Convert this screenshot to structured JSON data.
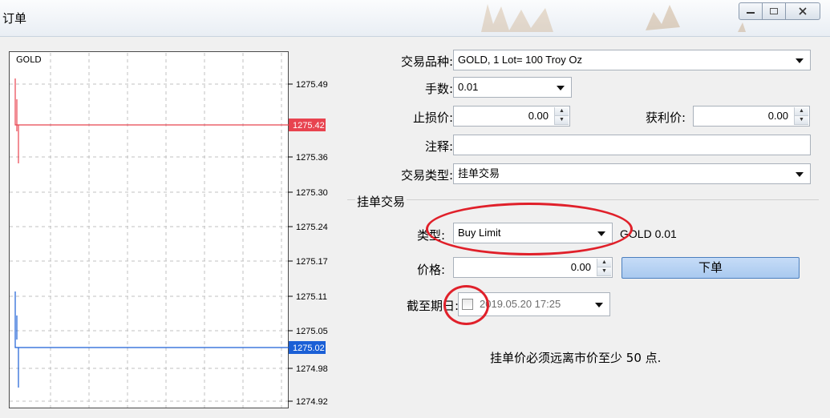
{
  "window": {
    "title": "订单"
  },
  "chart": {
    "symbol": "GOLD",
    "price_ticks": [
      "1275.49",
      "1275.42",
      "1275.36",
      "1275.30",
      "1275.24",
      "1275.17",
      "1275.11",
      "1275.05",
      "1275.02",
      "1274.98",
      "1274.92"
    ],
    "ask_label": "1275.42",
    "bid_label": "1275.02",
    "ask_color": "#e8434f",
    "bid_color": "#1a5fd6"
  },
  "form": {
    "symbol_label": "交易品种:",
    "symbol_value": "GOLD, 1 Lot= 100 Troy Oz",
    "volume_label": "手数:",
    "volume_value": "0.01",
    "stoploss_label": "止损价:",
    "stoploss_value": "0.00",
    "takeprofit_label": "获利价:",
    "takeprofit_value": "0.00",
    "comment_label": "注释:",
    "comment_value": "",
    "type_label": "交易类型:",
    "type_value": "挂单交易"
  },
  "pending": {
    "group_title": "挂单交易",
    "order_type_label": "类型:",
    "order_type_value": "Buy Limit",
    "symbol_volume": "GOLD 0.01",
    "price_label": "价格:",
    "price_value": "0.00",
    "submit_label": "下单",
    "expiry_label": "截至期日:",
    "expiry_value": "2019.05.20 17:25",
    "expiry_checked": false,
    "note": "挂单价必须远离市价至少 50 点."
  },
  "highlight_color": "#e0202a"
}
